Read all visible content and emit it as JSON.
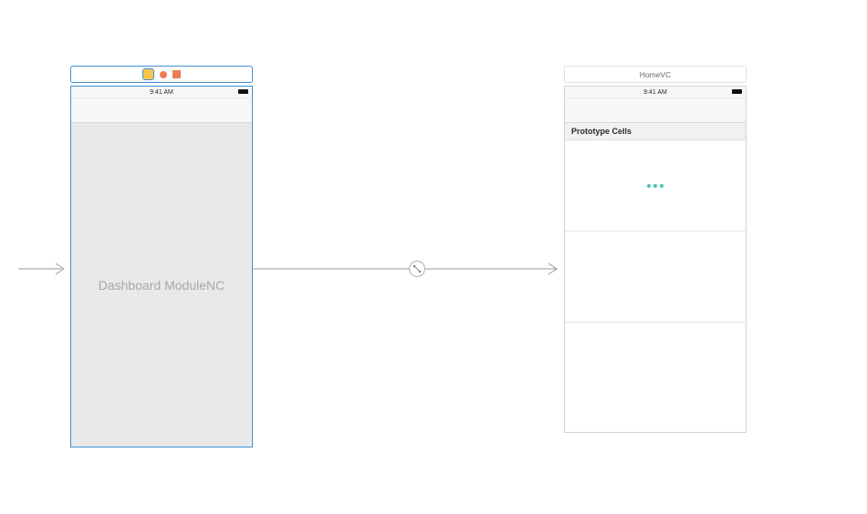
{
  "leftScene": {
    "titleIcons": [
      "yellow",
      "orange-circle",
      "orange-square"
    ],
    "statusTime": "9:41 AM",
    "placeholder": "Dashboard ModuleNC"
  },
  "rightScene": {
    "title": "HomeVC",
    "statusTime": "9:41 AM",
    "sectionHeader": "Prototype Cells"
  }
}
